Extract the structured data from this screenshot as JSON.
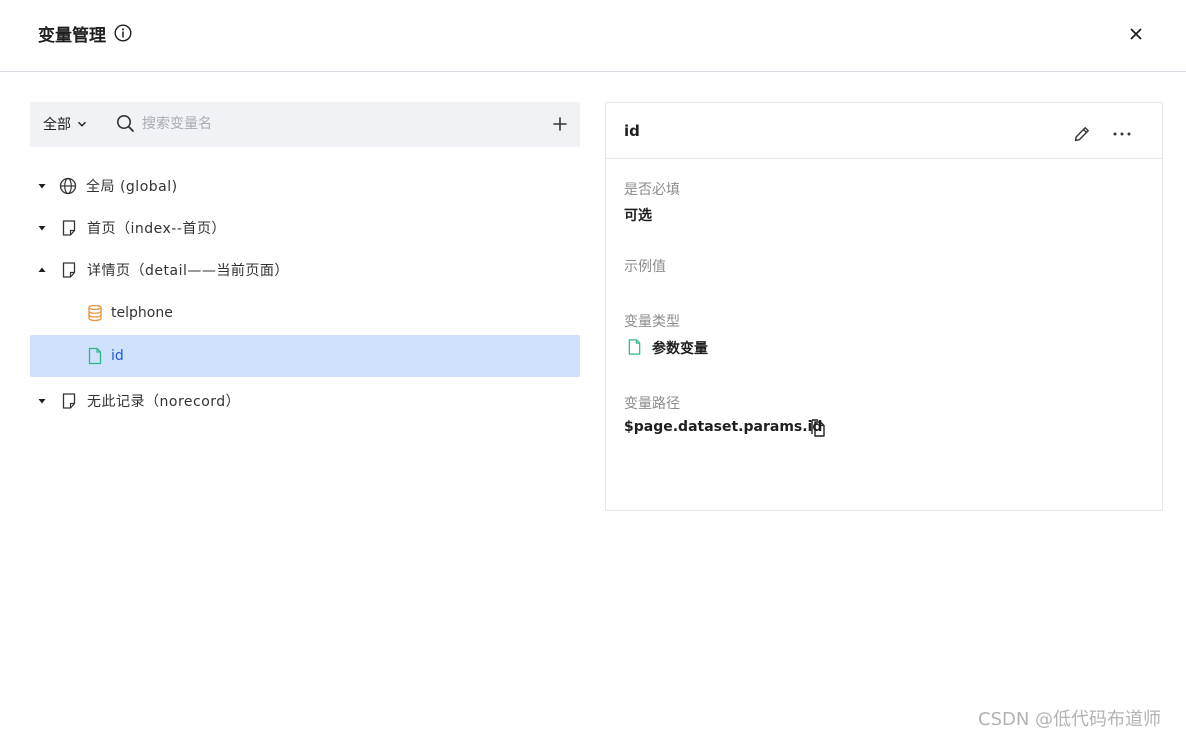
{
  "dialog": {
    "title": "变量管理",
    "close_icon": "close-icon",
    "info_icon": "info-circle-icon"
  },
  "filter": {
    "scope_value": "全部",
    "search_placeholder": "搜索变量名",
    "add_icon": "plus-icon"
  },
  "tree": {
    "nodes": [
      {
        "label": "全局 (global)",
        "icon": "globe-icon",
        "expanded": false
      },
      {
        "label": "首页（index--首页）",
        "icon": "page-icon",
        "expanded": false
      },
      {
        "label": "详情页（detail——当前页面）",
        "icon": "page-icon",
        "expanded": true
      },
      {
        "label": "telphone",
        "icon": "database-icon",
        "child": true
      },
      {
        "label": "id",
        "icon": "file-icon",
        "child": true,
        "selected": true
      },
      {
        "label": "无此记录（norecord）",
        "icon": "page-icon",
        "expanded": false
      }
    ]
  },
  "detail": {
    "name": "id",
    "required_label": "是否必填",
    "required_value": "可选",
    "example_label": "示例值",
    "example_value": "",
    "type_label": "变量类型",
    "type_value": "参数变量",
    "path_label": "变量路径",
    "path_value": "$page.dataset.params.id"
  },
  "colors": {
    "selected_bg": "#d0e1fb",
    "selected_text": "#1d5cd6",
    "database_icon": "#e8923a",
    "file_icon": "#2fb58a"
  },
  "watermark": "CSDN @低代码布道师"
}
